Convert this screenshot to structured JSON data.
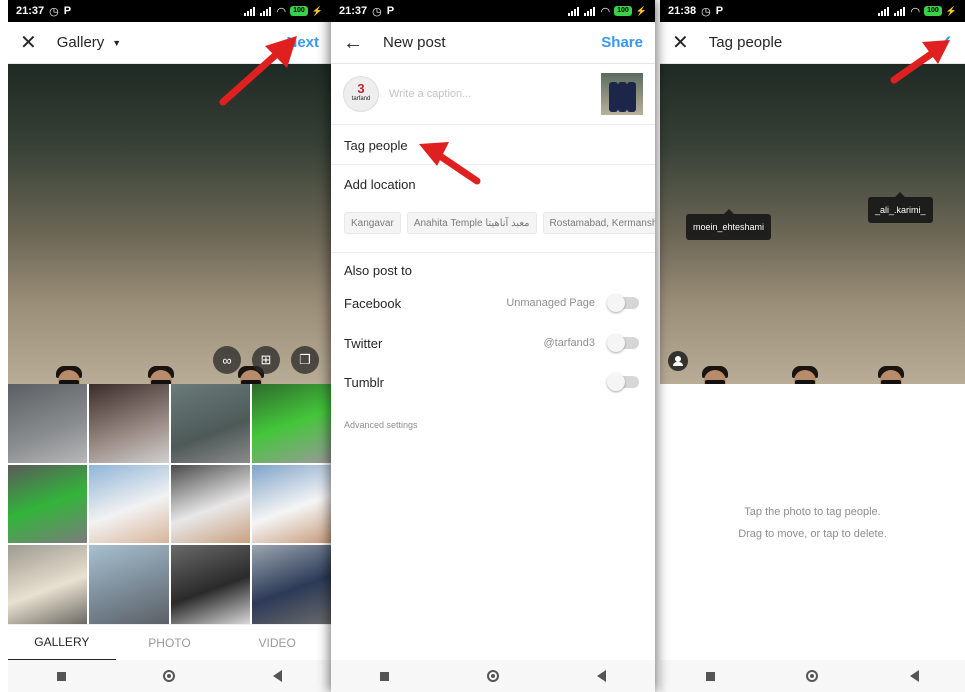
{
  "screens": {
    "gallery": {
      "status": {
        "time": "21:37",
        "battery": "100"
      },
      "header": {
        "title": "Gallery",
        "action": "Next"
      },
      "tabs": [
        "GALLERY",
        "PHOTO",
        "VIDEO"
      ]
    },
    "new_post": {
      "status": {
        "time": "21:37",
        "battery": "100"
      },
      "header": {
        "title": "New post",
        "action": "Share"
      },
      "avatar_text": "3",
      "avatar_sub": "tarfand",
      "caption_placeholder": "Write a caption...",
      "tag_people": "Tag people",
      "add_location": "Add location",
      "location_suggestions": [
        "Kangavar",
        "Anahita Temple  معبد آناهیتا",
        "Rostamabad, Kermanshah"
      ],
      "also_post_to": "Also post to",
      "share_targets": [
        {
          "name": "Facebook",
          "meta": "Unmanaged Page"
        },
        {
          "name": "Twitter",
          "meta": "@tarfand3"
        },
        {
          "name": "Tumblr",
          "meta": ""
        }
      ],
      "advanced_settings": "Advanced settings"
    },
    "tag_people": {
      "status": {
        "time": "21:38",
        "battery": "100"
      },
      "header": {
        "title": "Tag people"
      },
      "tags": [
        "moein_ehteshami",
        "_ali_.karimi_"
      ],
      "hint_line1": "Tap the photo to tag people.",
      "hint_line2": "Drag to move, or tap to delete."
    }
  },
  "icons": {
    "close": "close-icon",
    "back": "arrow-left-icon",
    "confirm": "checkmark-icon",
    "boomerang": "infinity-icon",
    "layout": "layout-icon",
    "multi_select": "multi-select-icon",
    "user": "user-icon"
  },
  "colors": {
    "accent": "#3897f0",
    "arrow": "#e02020",
    "battery": "#3bd14a"
  }
}
